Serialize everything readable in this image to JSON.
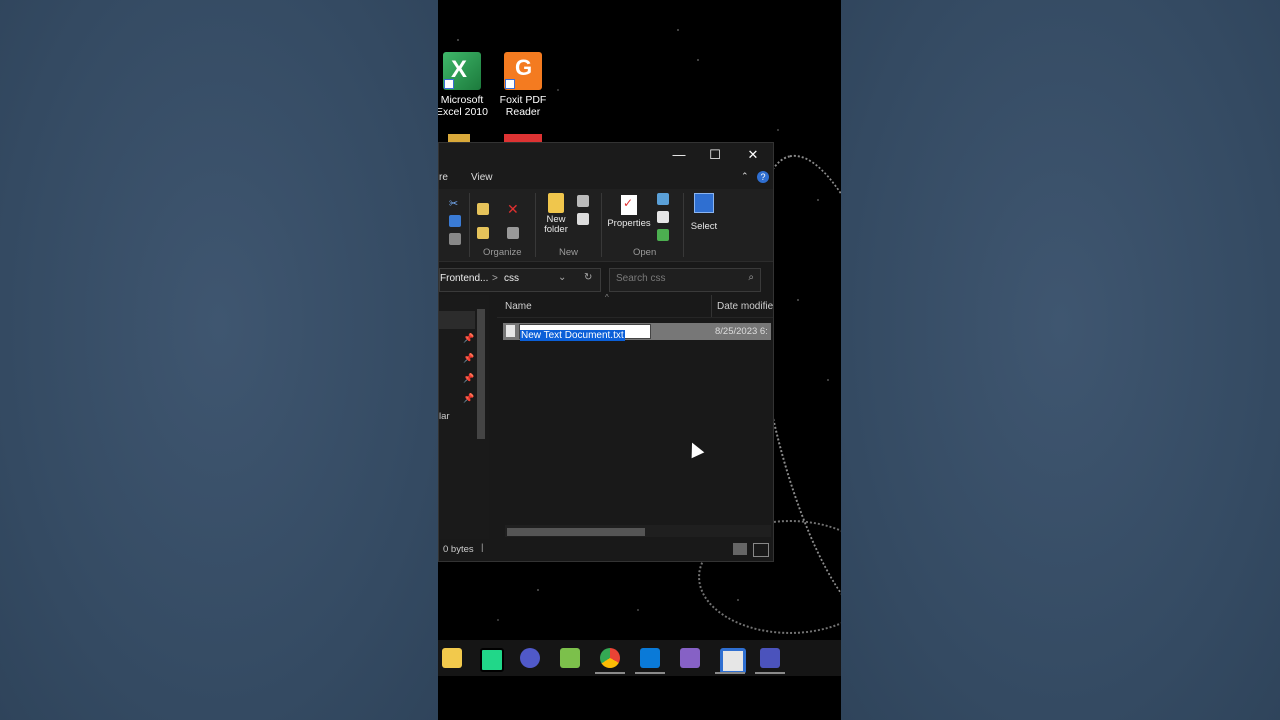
{
  "desktop_icons": [
    {
      "label": "Microsoft Excel 2010",
      "icon": "excel-icon"
    },
    {
      "label": "Foxit PDF Reader",
      "icon": "foxit-pdf-icon"
    }
  ],
  "window": {
    "controls": {
      "minimize": "—",
      "maximize": "☐",
      "close": "✕"
    },
    "menu": {
      "partial_tab": "re",
      "view": "View",
      "help": "?"
    },
    "ribbon": {
      "new_folder": "New folder",
      "properties": "Properties",
      "select": "Select",
      "groups": [
        "Organize",
        "New",
        "Open"
      ]
    },
    "address": {
      "crumb": "Frontend...",
      "separator": ">",
      "folder": "css"
    },
    "search": {
      "placeholder": "Search css"
    },
    "columns": {
      "name": "Name",
      "date": "Date modifie"
    },
    "file": {
      "name": "New Text Document.txt",
      "date": "8/25/2023 6:"
    },
    "nav_partial": "lar",
    "status": {
      "size": "0 bytes"
    }
  },
  "colors": {
    "accent": "#0a5fd8",
    "window_bg": "#191919"
  },
  "taskbar": {
    "apps": [
      "sticky-notes-icon",
      "pycharm-icon",
      "teams-icon",
      "notepad-plus-icon",
      "chrome-icon",
      "vscode-icon",
      "visual-studio-icon",
      "app-window-icon",
      "teams-work-icon"
    ]
  }
}
